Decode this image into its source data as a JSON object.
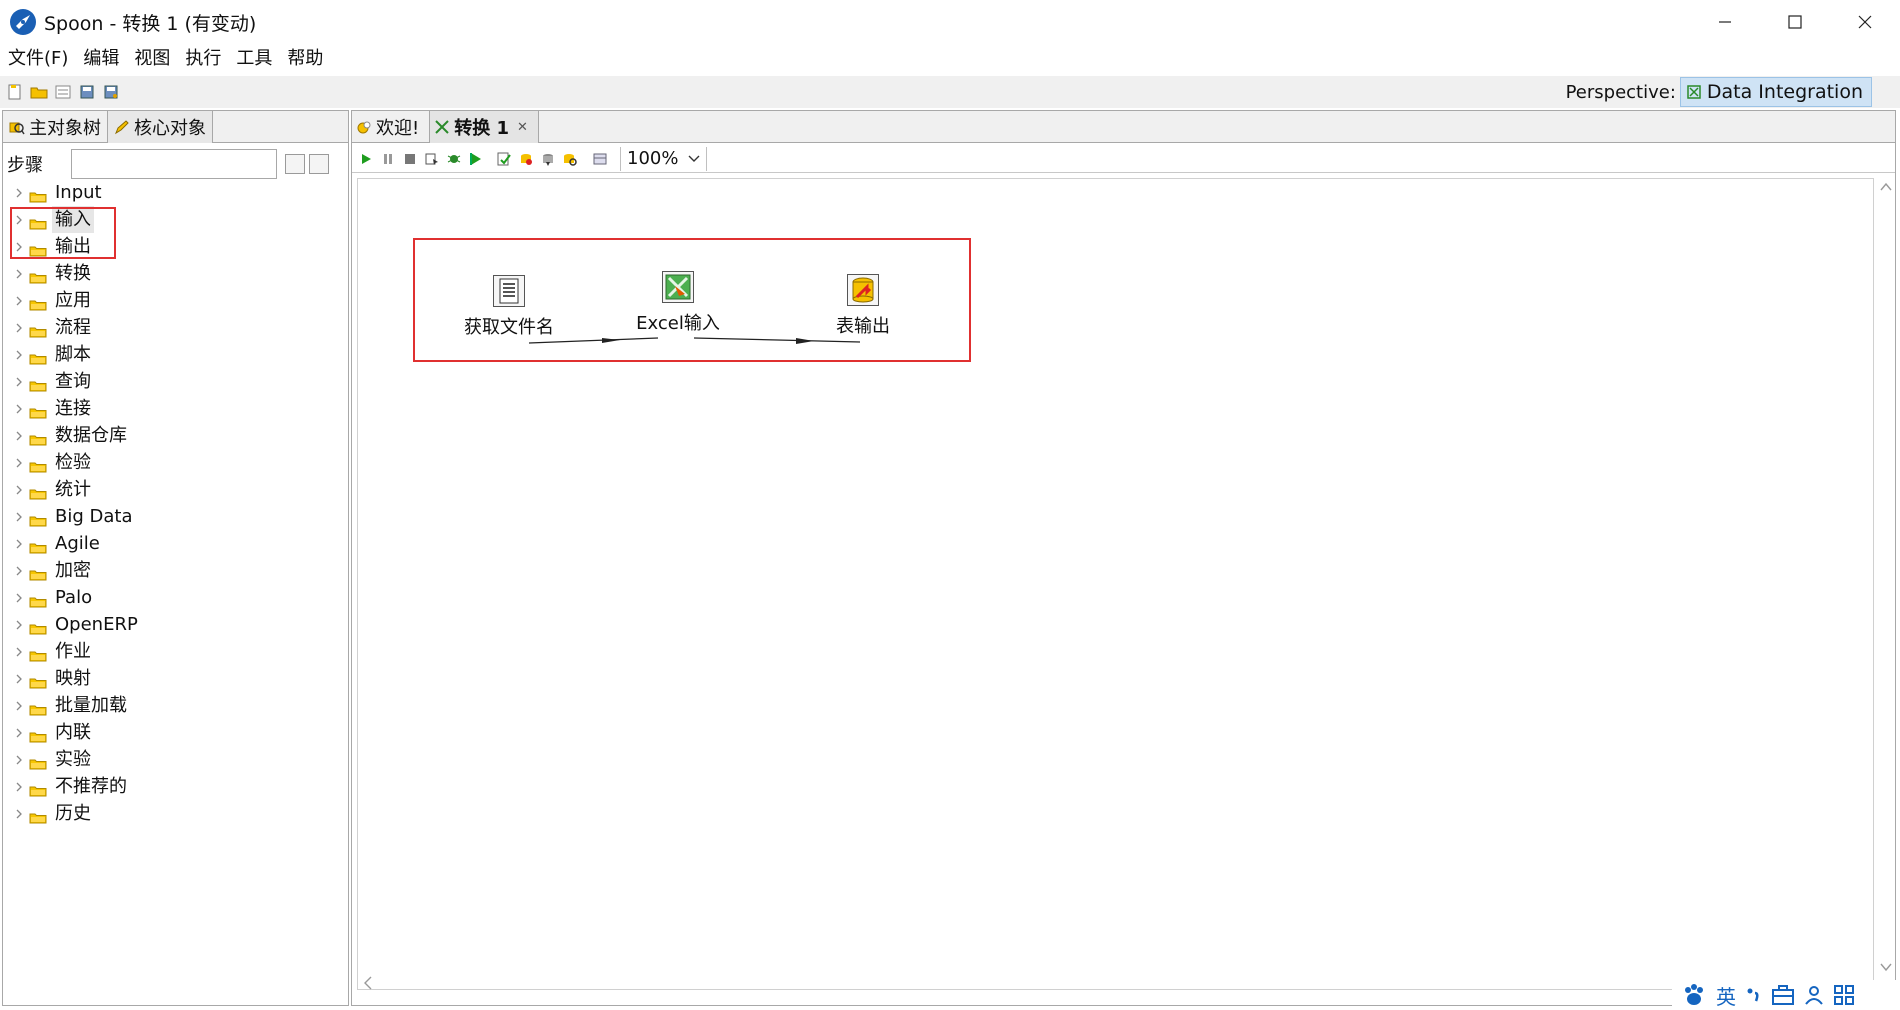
{
  "window": {
    "title": "Spoon - 转换 1 (有变动)"
  },
  "menu": [
    "文件(F)",
    "编辑",
    "视图",
    "执行",
    "工具",
    "帮助"
  ],
  "perspective": {
    "label": "Perspective:",
    "value": "Data Integration"
  },
  "left_tabs": [
    {
      "label": "主对象树",
      "icon": "search-tree-icon"
    },
    {
      "label": "核心对象",
      "icon": "pencil-icon"
    }
  ],
  "steps": {
    "label": "步骤",
    "search_value": ""
  },
  "tree": [
    "Input",
    "输入",
    "输出",
    "转换",
    "应用",
    "流程",
    "脚本",
    "查询",
    "连接",
    "数据仓库",
    "检验",
    "统计",
    "Big Data",
    "Agile",
    "加密",
    "Palo",
    "OpenERP",
    "作业",
    "映射",
    "批量加载",
    "内联",
    "实验",
    "不推荐的",
    "历史"
  ],
  "right_tabs": [
    {
      "label": "欢迎!",
      "icon": "welcome-icon"
    },
    {
      "label": "转换 1",
      "icon": "transform-icon"
    }
  ],
  "canvas_toolbar": {
    "zoom": "100%"
  },
  "steps_on_canvas": [
    {
      "label": "获取文件名",
      "icon": "document-icon"
    },
    {
      "label": "Excel输入",
      "icon": "excel-input-icon"
    },
    {
      "label": "表输出",
      "icon": "table-output-icon"
    }
  ],
  "ime": {
    "lang": "英"
  }
}
